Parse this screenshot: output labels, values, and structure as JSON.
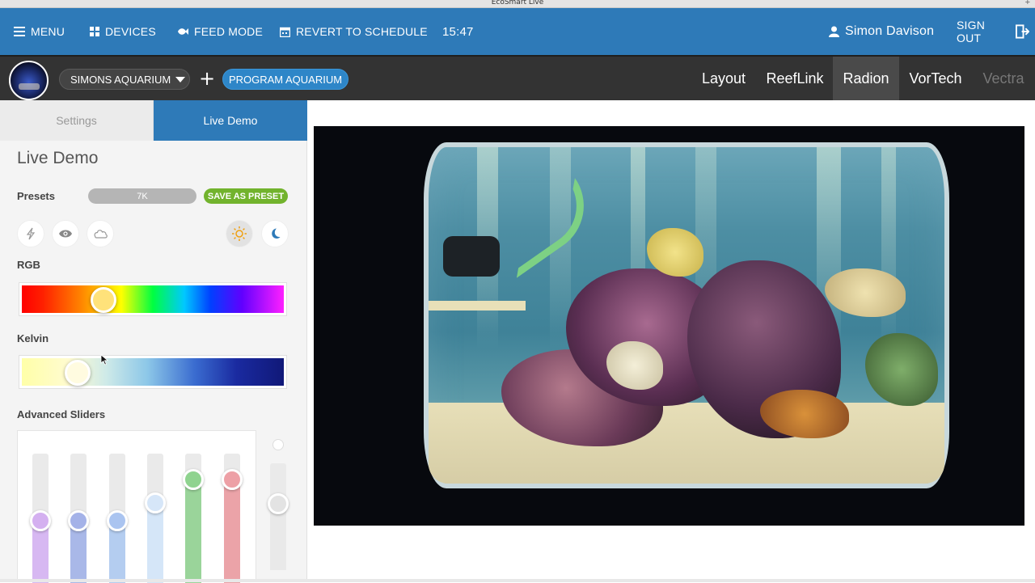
{
  "window": {
    "title": "EcoSmart Live"
  },
  "topnav": {
    "menu_label": "MENU",
    "devices_label": "DEVICES",
    "feed_mode_label": "FEED MODE",
    "revert_label": "REVERT TO SCHEDULE",
    "time": "15:47",
    "user_name": "Simon Davison",
    "sign_out_label": "SIGN OUT"
  },
  "subnav": {
    "aquarium_name": "SIMONS AQUARIUM",
    "add_label": "+",
    "program_label": "PROGRAM AQUARIUM",
    "device_tabs": [
      {
        "label": "Layout",
        "state": "normal"
      },
      {
        "label": "ReefLink",
        "state": "normal"
      },
      {
        "label": "Radion",
        "state": "active"
      },
      {
        "label": "VorTech",
        "state": "normal"
      },
      {
        "label": "Vectra",
        "state": "disabled"
      }
    ]
  },
  "sidebar": {
    "tabs": [
      {
        "label": "Settings"
      },
      {
        "label": "Live Demo"
      }
    ],
    "heading": "Live Demo",
    "presets_label": "Presets",
    "preset_value": "7K",
    "save_preset_label": "SAVE AS PRESET",
    "mode_icons": [
      "lightning-icon",
      "eye-icon",
      "cloud-icon",
      "sun-icon",
      "moon-icon"
    ],
    "rgb_label": "RGB",
    "rgb_position": 0.31,
    "rgb_knob_color": "#ffe27a",
    "kelvin_label": "Kelvin",
    "kelvin_position": 0.21,
    "kelvin_knob_color": "#fffbe0",
    "advanced_label": "Advanced Sliders",
    "channels": [
      {
        "color": "#d7b8f2",
        "knob": "#d4b0f0",
        "level": 0.48
      },
      {
        "color": "#a9b8e8",
        "knob": "#a4b2e8",
        "level": 0.48
      },
      {
        "color": "#b4cdf0",
        "knob": "#aac4f0",
        "level": 0.48
      },
      {
        "color": "#d5e6f8",
        "knob": "#d6e6f8",
        "level": 0.62
      },
      {
        "color": "#9ad49a",
        "knob": "#8fd38f",
        "level": 0.8
      },
      {
        "color": "#eba3a8",
        "knob": "#eda0a6",
        "level": 0.8
      },
      {
        "color": "#e9e9e9",
        "knob": "#e3e3e3",
        "level": 0.62
      }
    ]
  },
  "colors": {
    "brand_blue": "#2e7ab8",
    "subnav_bg": "#333333",
    "save_green": "#72b32d"
  }
}
